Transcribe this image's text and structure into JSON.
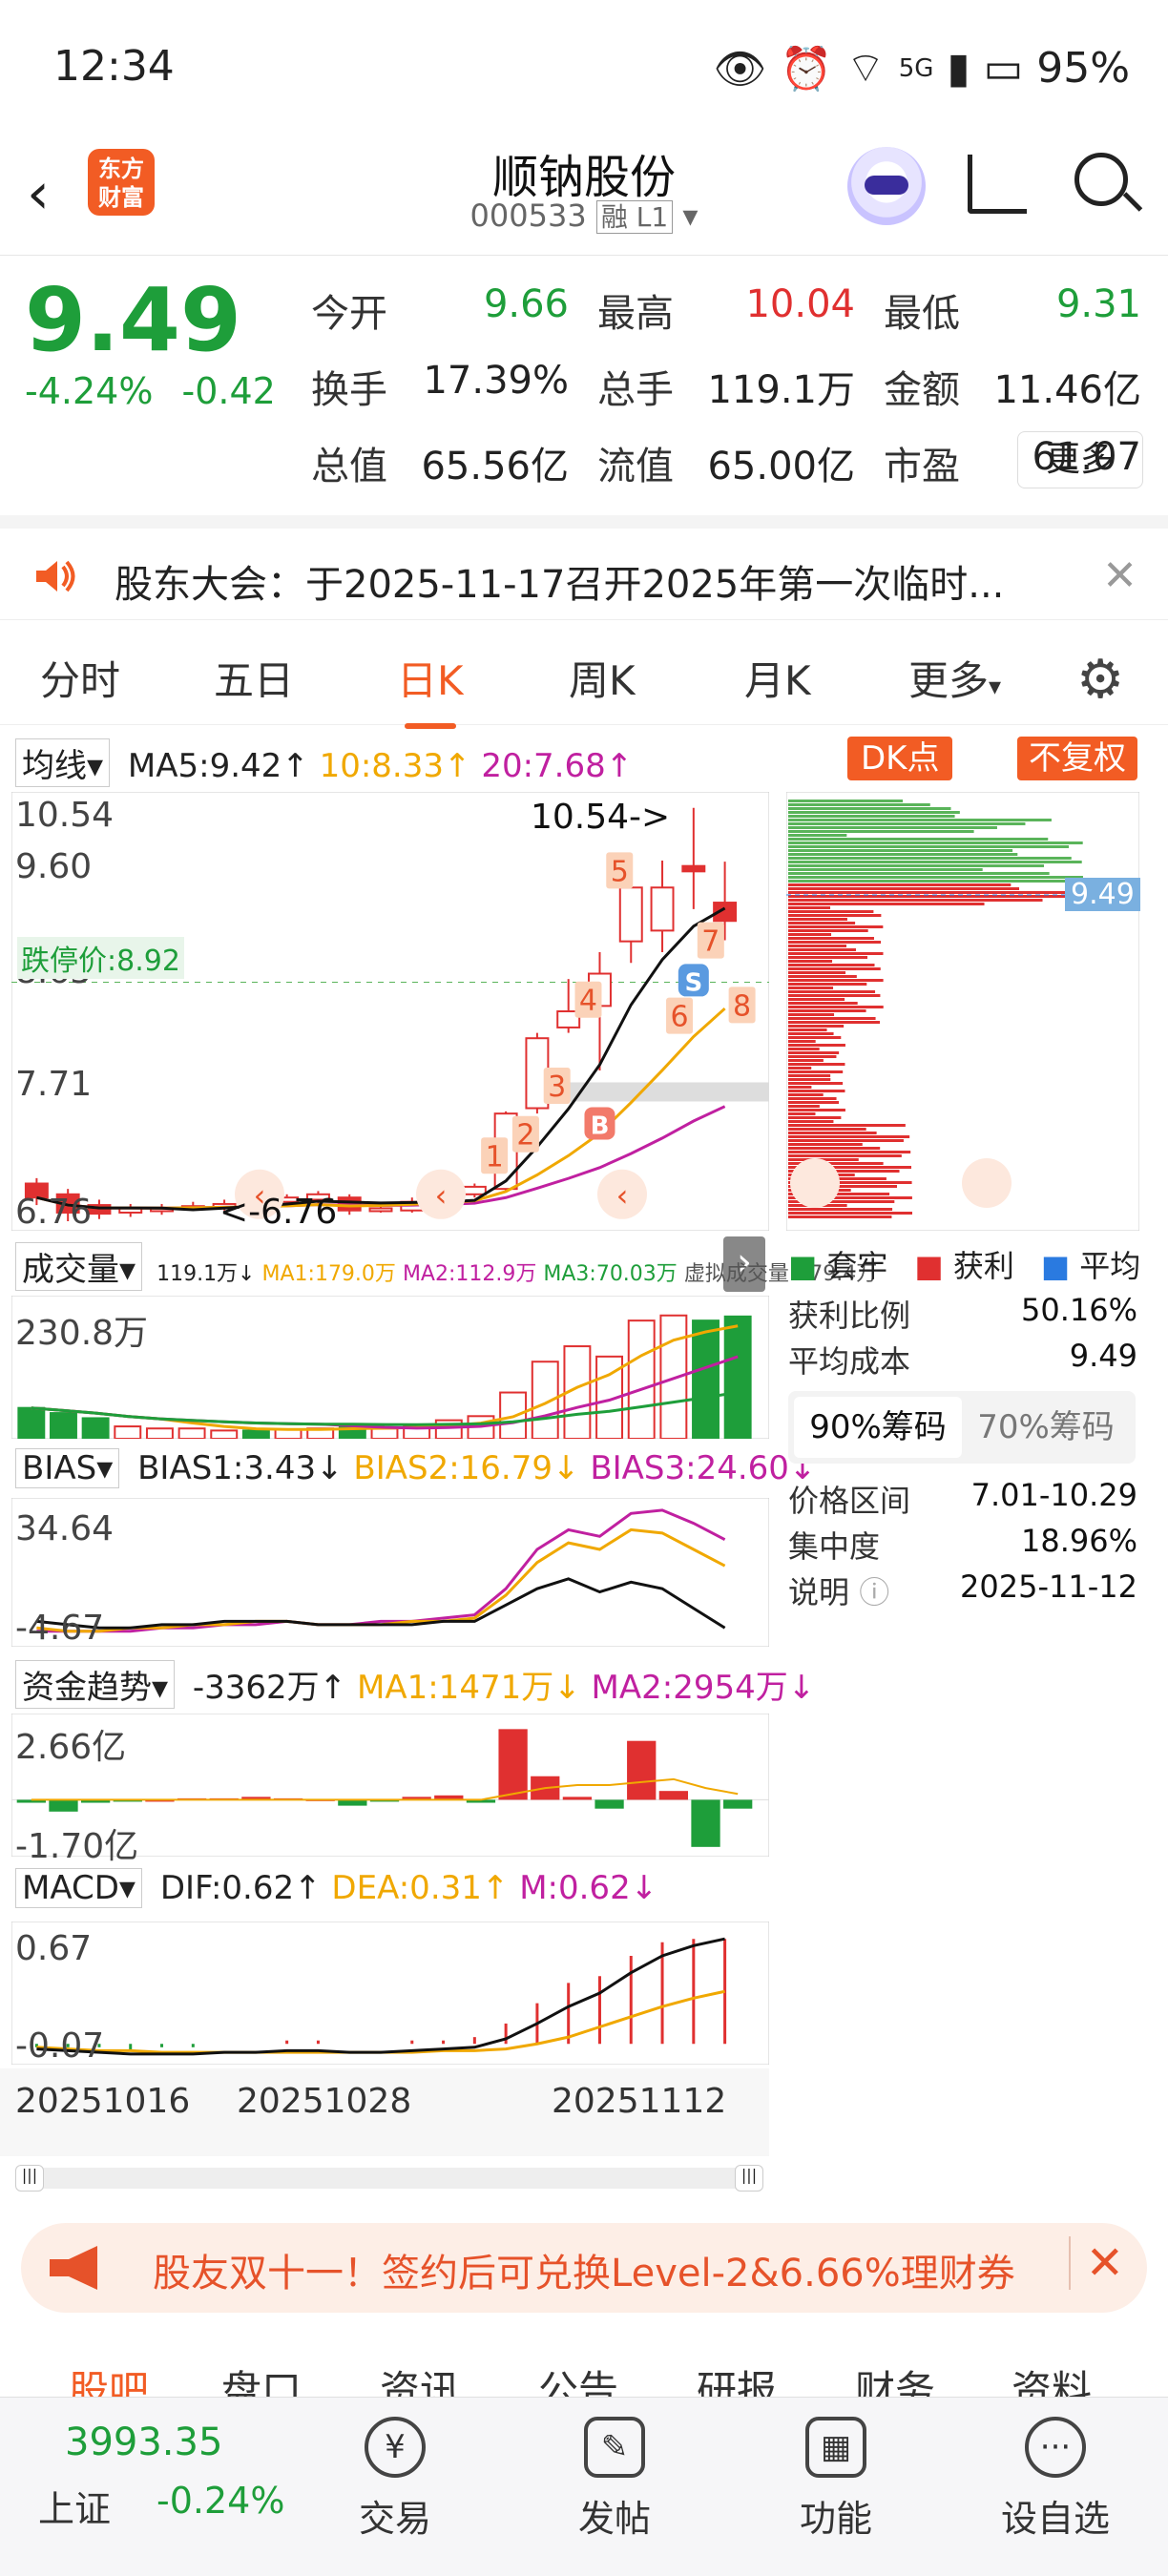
{
  "status_bar": {
    "time": "12:34",
    "network": "5G",
    "battery": "95%"
  },
  "header": {
    "logo_text": "东方\n财富",
    "stock_name": "顺钠股份",
    "stock_code": "000533",
    "tags": "融 L1"
  },
  "quote": {
    "price": "9.49",
    "change_pct": "-4.24%",
    "change_abs": "-0.42",
    "fields": [
      {
        "label": "今开",
        "value": "9.66",
        "color": "#1e9e3a"
      },
      {
        "label": "最高",
        "value": "10.04",
        "color": "#e03030"
      },
      {
        "label": "最低",
        "value": "9.31",
        "color": "#1e9e3a"
      },
      {
        "label": "换手",
        "value": "17.39%",
        "color": "#222"
      },
      {
        "label": "总手",
        "value": "119.1万",
        "color": "#222"
      },
      {
        "label": "金额",
        "value": "11.46亿",
        "color": "#222"
      },
      {
        "label": "总值",
        "value": "65.56亿",
        "color": "#222"
      },
      {
        "label": "流值",
        "value": "65.00亿",
        "color": "#222"
      },
      {
        "label": "市盈",
        "value": "61.07",
        "color": "#222"
      }
    ],
    "pe_sup": "动",
    "more": "更多"
  },
  "notice": {
    "text": "股东大会：于2025-11-17召开2025年第一次临时..."
  },
  "tabs": [
    "分时",
    "五日",
    "日K",
    "周K",
    "月K",
    "更多"
  ],
  "active_tab": "日K",
  "kline": {
    "ma_select": "均线",
    "ma5": "MA5:9.42↑",
    "ma10": "10:8.33↑",
    "ma20": "20:7.68↑",
    "dk_button": "DK点",
    "fq_button": "不复权",
    "price_high": "10.54",
    "price_mid1": "9.60",
    "price_mid2": "8.65",
    "price_mid3": "7.71",
    "price_low": "6.76",
    "limit_down": "跌停价:8.92",
    "max_label": "10.54->",
    "min_label": "<-6.76",
    "markers": [
      "1",
      "2",
      "3",
      "4",
      "5",
      "6",
      "7",
      "8"
    ],
    "b_marker": "B",
    "s_marker": "S",
    "current_badge": "9.49"
  },
  "volume": {
    "select": "成交量",
    "text": "119.1万↓",
    "ma1": "MA1:179.0万",
    "ma2": "MA2:112.9万",
    "ma3": "MA3:70.03万",
    "virtual": "虚拟成交量:179.4万",
    "axis": "230.8万"
  },
  "bias": {
    "select": "BIAS",
    "b1": "BIAS1:3.43↓",
    "b2": "BIAS2:16.79↓",
    "b3": "BIAS3:24.60↓",
    "axis_top": "34.64",
    "axis_bottom": "-4.67"
  },
  "fund": {
    "select": "资金趋势",
    "v": "-3362万↑",
    "ma1": "MA1:1471万↓",
    "ma2": "MA2:2954万↓",
    "axis_top": "2.66亿",
    "axis_bottom": "-1.70亿"
  },
  "macd": {
    "select": "MACD",
    "dif": "DIF:0.62↑",
    "dea": "DEA:0.31↑",
    "m": "M:0.62↓",
    "axis_top": "0.67",
    "axis_bottom": "-0.07"
  },
  "dates": [
    "20251016",
    "20251028",
    "20251112"
  ],
  "chips": {
    "legend": [
      "套牢",
      "获利",
      "平均"
    ],
    "rows": [
      {
        "label": "获利比例",
        "value": "50.16%"
      },
      {
        "label": "平均成本",
        "value": "9.49"
      }
    ],
    "tabs": [
      "90%筹码",
      "70%筹码"
    ],
    "rows2": [
      {
        "label": "价格区间",
        "value": "7.01-10.29"
      },
      {
        "label": "集中度",
        "value": "18.96%"
      },
      {
        "label": "说明",
        "value": "2025-11-12"
      }
    ]
  },
  "candles": [
    {
      "o": 7.05,
      "c": 6.92,
      "h": 7.1,
      "l": 6.85
    },
    {
      "o": 6.95,
      "c": 6.78,
      "h": 7.0,
      "l": 6.7
    },
    {
      "o": 6.85,
      "c": 6.77,
      "h": 6.9,
      "l": 6.72
    },
    {
      "o": 6.78,
      "c": 6.82,
      "h": 6.86,
      "l": 6.74
    },
    {
      "o": 6.8,
      "c": 6.82,
      "h": 6.86,
      "l": 6.76
    },
    {
      "o": 6.82,
      "c": 6.84,
      "h": 6.88,
      "l": 6.8
    },
    {
      "o": 6.85,
      "c": 6.86,
      "h": 6.9,
      "l": 6.8
    },
    {
      "o": 6.88,
      "c": 6.86,
      "h": 6.92,
      "l": 6.82
    },
    {
      "o": 6.88,
      "c": 6.92,
      "h": 6.95,
      "l": 6.84
    },
    {
      "o": 6.9,
      "c": 6.95,
      "h": 6.98,
      "l": 6.85
    },
    {
      "o": 6.92,
      "c": 6.8,
      "h": 6.95,
      "l": 6.76
    },
    {
      "o": 6.82,
      "c": 6.82,
      "h": 6.86,
      "l": 6.78
    },
    {
      "o": 6.8,
      "c": 6.88,
      "h": 6.92,
      "l": 6.78
    },
    {
      "o": 6.88,
      "c": 6.95,
      "h": 7.0,
      "l": 6.85
    },
    {
      "o": 6.95,
      "c": 7.02,
      "h": 7.05,
      "l": 6.92
    },
    {
      "o": 7.0,
      "c": 7.7,
      "h": 7.72,
      "l": 6.98
    },
    {
      "o": 7.75,
      "c": 8.4,
      "h": 8.45,
      "l": 7.7
    },
    {
      "o": 8.5,
      "c": 8.65,
      "h": 8.95,
      "l": 8.45
    },
    {
      "o": 8.7,
      "c": 9.0,
      "h": 9.2,
      "l": 8.1
    },
    {
      "o": 9.3,
      "c": 9.8,
      "h": 9.9,
      "l": 9.1
    },
    {
      "o": 9.4,
      "c": 9.8,
      "h": 10.05,
      "l": 9.2
    },
    {
      "o": 10.0,
      "c": 9.95,
      "h": 10.54,
      "l": 9.6
    },
    {
      "o": 9.66,
      "c": 9.49,
      "h": 10.04,
      "l": 9.31
    }
  ],
  "volumes": [
    30,
    25,
    20,
    12,
    10,
    10,
    8,
    8,
    9,
    10,
    14,
    10,
    12,
    18,
    22,
    45,
    75,
    90,
    80,
    115,
    120,
    115,
    119
  ],
  "bottom": {
    "index_value": "3993.35",
    "index_name": "上证",
    "index_change": "-0.24%",
    "nav": [
      "交易",
      "发帖",
      "功能",
      "设自选"
    ]
  },
  "subtabs": [
    "股吧",
    "盘口",
    "资讯",
    "公告",
    "研报",
    "财务",
    "资料"
  ],
  "ad": {
    "text": "股友双十一！签约后可兑换Level-2&6.66%理财券"
  },
  "colors": {
    "up": "#e03030",
    "down": "#1e9e3a",
    "accent": "#f25c24",
    "ma5": "#111111",
    "ma10": "#f0a800",
    "ma20": "#c020a0"
  }
}
